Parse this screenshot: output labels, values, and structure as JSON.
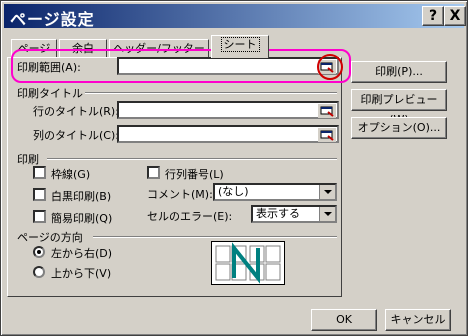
{
  "window": {
    "title": "ページ設定",
    "help_label": "?",
    "close_label": "X"
  },
  "tabs": [
    "ページ",
    "余白",
    "ヘッダー/フッター",
    "シート"
  ],
  "sheet": {
    "print_area_label": "印刷範囲(A):",
    "print_titles_label": "印刷タイトル",
    "row_title_label": "行のタイトル(R):",
    "col_title_label": "列のタイトル(C):",
    "print_group_label": "印刷",
    "gridlines_label": "枠線(G)",
    "bw_label": "白黒印刷(B)",
    "draft_label": "簡易印刷(Q)",
    "rowcol_headers_label": "行列番号(L)",
    "comments_label": "コメント(M):",
    "comments_value": "(なし)",
    "cell_errors_label": "セルのエラー(E):",
    "cell_errors_value": "表示する",
    "page_order_label": "ページの方向",
    "left_to_right_label": "左から右(D)",
    "top_to_bottom_label": "上から下(V)"
  },
  "side_buttons": {
    "print": "印刷(P)...",
    "preview": "印刷プレビュー(W)",
    "options": "オプション(O)..."
  },
  "footer_buttons": {
    "ok": "OK",
    "cancel": "キャンセル"
  },
  "colors": {
    "highlight": "#ff00cc",
    "circle": "#d00000",
    "title_start": "#0a246a"
  }
}
